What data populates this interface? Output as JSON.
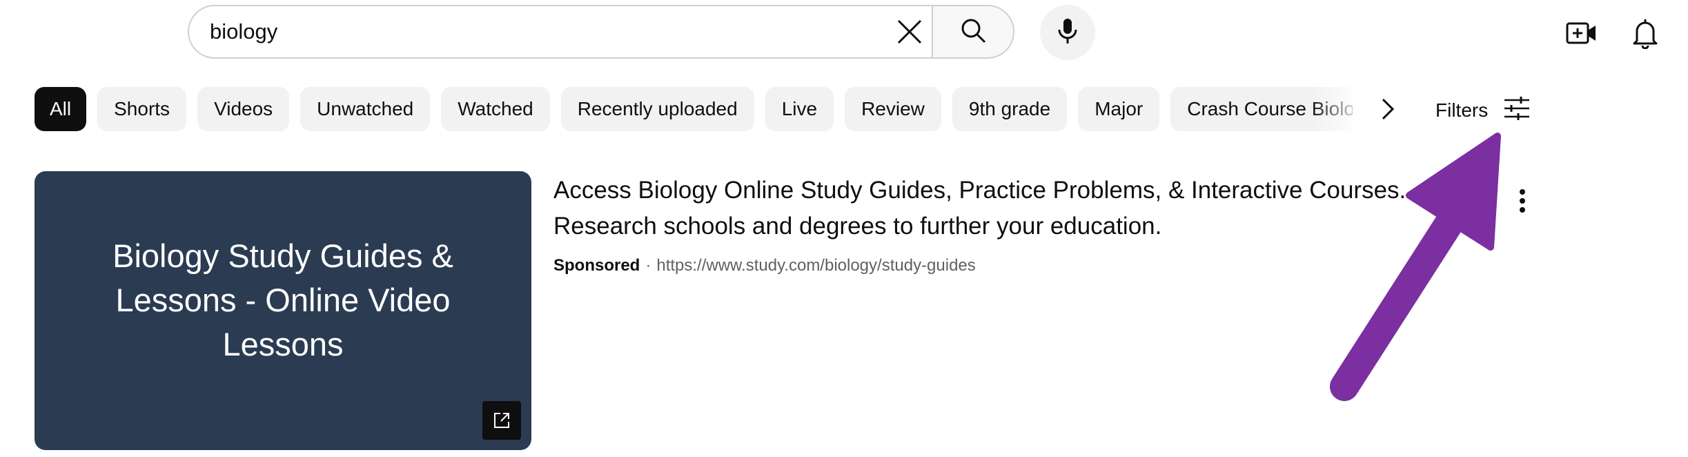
{
  "search": {
    "value": "biology",
    "clear_icon": "close-icon",
    "search_icon": "search-icon",
    "mic_icon": "microphone-icon"
  },
  "header_icons": {
    "create": "create-video-icon",
    "notifications": "bell-icon"
  },
  "chips": {
    "items": [
      {
        "label": "All",
        "active": true
      },
      {
        "label": "Shorts"
      },
      {
        "label": "Videos"
      },
      {
        "label": "Unwatched"
      },
      {
        "label": "Watched"
      },
      {
        "label": "Recently uploaded"
      },
      {
        "label": "Live"
      },
      {
        "label": "Review"
      },
      {
        "label": "9th grade"
      },
      {
        "label": "Major"
      },
      {
        "label": "Crash Course Biology"
      }
    ],
    "next_icon": "chevron-right-icon"
  },
  "filters": {
    "label": "Filters",
    "icon": "sliders-icon"
  },
  "ad": {
    "thumbnail_text": "Biology Study Guides & Lessons - Online Video Lessons",
    "title": "Access Biology Online Study Guides, Practice Problems, & Interactive Courses. Research schools and degrees to further your education.",
    "sponsored_label": "Sponsored",
    "separator": "·",
    "url": "https://www.study.com/biology/study-guides",
    "external_icon": "external-link-icon",
    "more_icon": "more-vertical-icon"
  },
  "colors": {
    "annotation_arrow": "#7b2fa0",
    "thumbnail_bg": "#2b3b52",
    "chip_bg": "#f2f2f2",
    "chip_active_bg": "#0f0f0f"
  }
}
